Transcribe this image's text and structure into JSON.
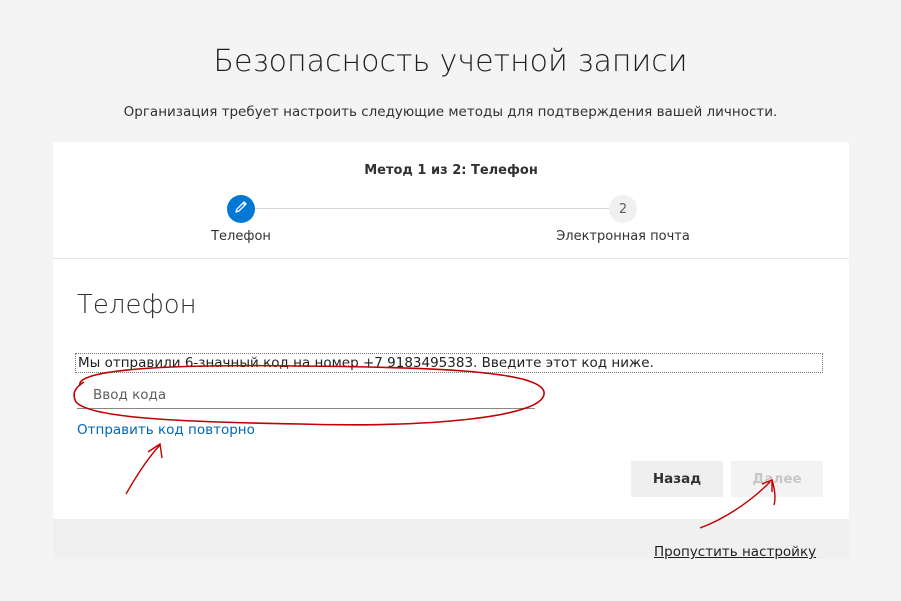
{
  "header": {
    "title": "Безопасность учетной записи",
    "subtitle": "Организация требует настроить следующие методы для подтверждения вашей личности."
  },
  "stepper": {
    "heading": "Метод 1 из 2: Телефон",
    "steps": [
      {
        "label": "Телефон",
        "icon": "pencil-icon",
        "state": "active"
      },
      {
        "label": "Электронная почта",
        "number": "2",
        "state": "pending"
      }
    ]
  },
  "main": {
    "section_title": "Телефон",
    "info_text": "Мы отправили 6-значный код на номер +7 9183495383. Введите этот код ниже.",
    "code_input": {
      "value": "",
      "placeholder": "Ввод кода"
    },
    "resend_link": "Отправить код повторно",
    "back_label": "Назад",
    "next_label": "Далее",
    "skip_link": "Пропустить настройку"
  },
  "colors": {
    "accent": "#0078d4",
    "link": "#0067b8",
    "annotation": "#c00000"
  }
}
